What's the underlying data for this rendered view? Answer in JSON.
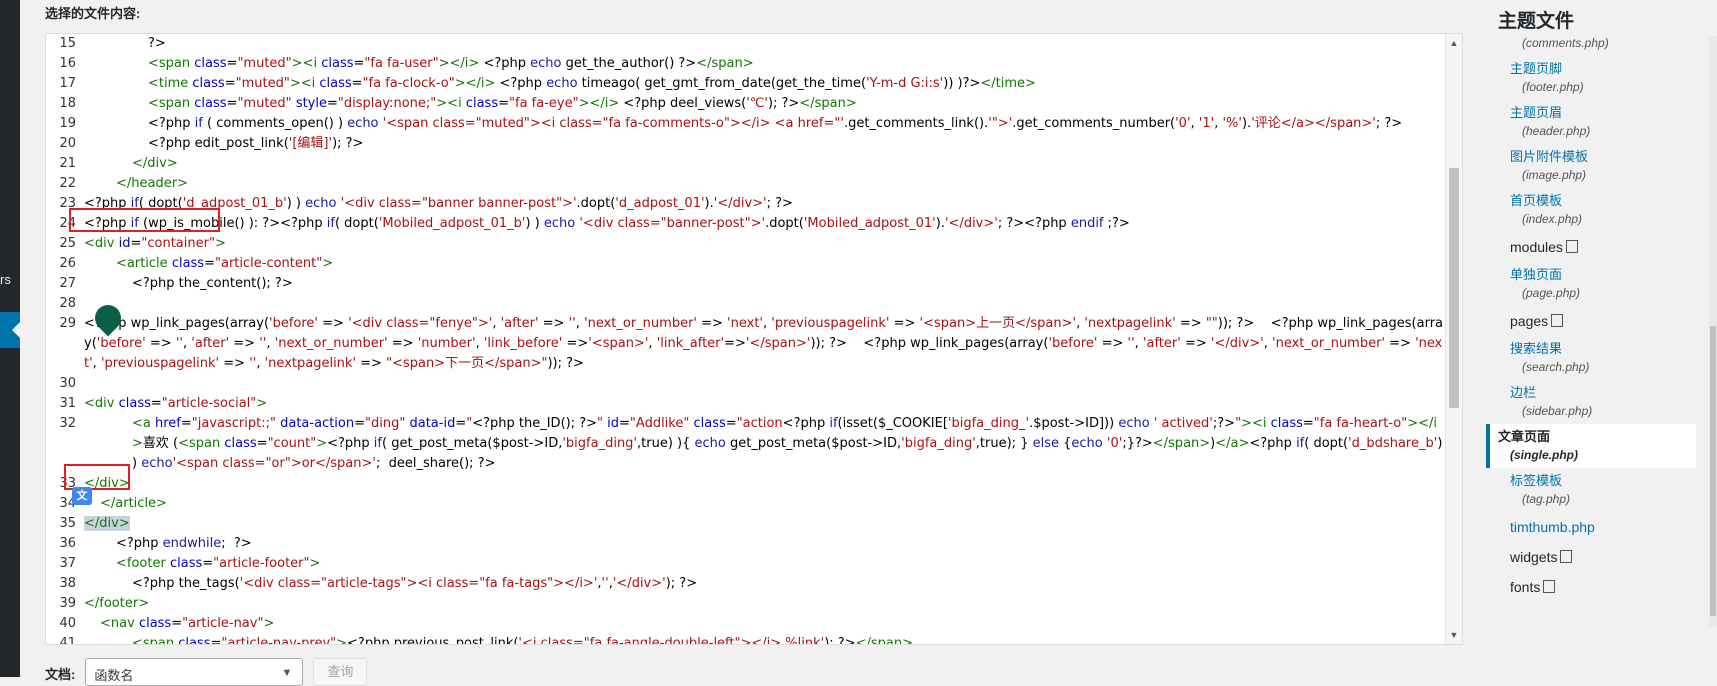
{
  "admin_strip": {
    "text": "rs"
  },
  "editor": {
    "content_label": "选择的文件内容:",
    "lines": [
      {
        "n": "15",
        "indent": 4,
        "html": "?>"
      },
      {
        "n": "16",
        "indent": 4,
        "html": "<span class=\"tag\">&lt;span</span> <span class=\"attr\">class</span>=<span class=\"str\">\"muted\"</span><span class=\"tag\">&gt;&lt;i</span> <span class=\"attr\">class</span>=<span class=\"str\">\"fa fa-user\"</span><span class=\"tag\">&gt;&lt;/i&gt;</span> &lt;?php <span class=\"kw\">echo</span> get_the_author() ?&gt;<span class=\"tag\">&lt;/span&gt;</span>"
      },
      {
        "n": "17",
        "indent": 4,
        "html": "<span class=\"tag\">&lt;time</span> <span class=\"attr\">class</span>=<span class=\"str\">\"muted\"</span><span class=\"tag\">&gt;&lt;i</span> <span class=\"attr\">class</span>=<span class=\"str\">\"fa fa-clock-o\"</span><span class=\"tag\">&gt;&lt;/i&gt;</span> &lt;?php <span class=\"kw\">echo</span> timeago( get_gmt_from_date(get_the_time(<span class=\"str\">'Y-m-d G:i:s'</span>)) )?&gt;<span class=\"tag\">&lt;/time&gt;</span>"
      },
      {
        "n": "18",
        "indent": 4,
        "html": "<span class=\"tag\">&lt;span</span> <span class=\"attr\">class</span>=<span class=\"str\">\"muted\"</span> <span class=\"attr\">style</span>=<span class=\"str\">\"display:none;\"</span><span class=\"tag\">&gt;&lt;i</span> <span class=\"attr\">class</span>=<span class=\"str\">\"fa fa-eye\"</span><span class=\"tag\">&gt;&lt;/i&gt;</span> &lt;?php deel_views(<span class=\"str\">'℃'</span>); ?&gt;<span class=\"tag\">&lt;/span&gt;</span>"
      },
      {
        "n": "19",
        "indent": 4,
        "html": "&lt;?php <span class=\"kw\">if</span> ( comments_open() ) <span class=\"kw\">echo</span> <span class=\"str\">'&lt;span class=\"muted\"&gt;&lt;i class=\"fa fa-comments-o\"&gt;&lt;/i&gt; &lt;a href=\"'</span>.get_comments_link().<span class=\"str\">'\"&gt;'</span>.get_comments_number(<span class=\"str\">'0'</span>, <span class=\"str\">'1'</span>, <span class=\"str\">'%'</span>).<span class=\"str\">'评论&lt;/a&gt;&lt;/span&gt;'</span>; ?&gt;"
      },
      {
        "n": "20",
        "indent": 4,
        "html": "&lt;?php edit_post_link(<span class=\"str\">'[编辑]'</span>); ?&gt;"
      },
      {
        "n": "21",
        "indent": 3,
        "html": "<span class=\"tag\">&lt;/div&gt;</span>"
      },
      {
        "n": "22",
        "indent": 2,
        "html": "<span class=\"tag\">&lt;/header&gt;</span>"
      },
      {
        "n": "23",
        "indent": 0,
        "html": "&lt;?php <span class=\"kw\">if</span>( dopt(<span class=\"str\">'d_adpost_01_b'</span>) ) <span class=\"kw\">echo</span> <span class=\"str\">'&lt;div class=\"banner banner-post\"&gt;'</span>.dopt(<span class=\"str\">'d_adpost_01'</span>).<span class=\"str\">'&lt;/div&gt;'</span>; ?&gt;"
      },
      {
        "n": "24",
        "indent": 0,
        "html": "&lt;?php <span class=\"kw\">if</span> (wp_is_mobile() ): ?&gt;&lt;?php <span class=\"kw\">if</span>( dopt(<span class=\"str\">'Mobiled_adpost_01_b'</span>) ) <span class=\"kw\">echo</span> <span class=\"str\">'&lt;div class=\"banner-post\"&gt;'</span>.dopt(<span class=\"str\">'Mobiled_adpost_01'</span>).<span class=\"str\">'&lt;/div&gt;'</span>; ?&gt;&lt;?php <span class=\"kw\">endif</span> ;?&gt;"
      },
      {
        "n": "25",
        "indent": 0,
        "html": "<span class=\"tag\">&lt;div</span> <span class=\"attr\">id</span>=<span class=\"str\">\"container\"</span><span class=\"tag\">&gt;</span>"
      },
      {
        "n": "26",
        "indent": 2,
        "html": "<span class=\"tag\">&lt;article</span> <span class=\"attr\">class</span>=<span class=\"str\">\"article-content\"</span><span class=\"tag\">&gt;</span>"
      },
      {
        "n": "27",
        "indent": 3,
        "html": "&lt;?php the_content(); ?&gt;"
      },
      {
        "n": "28",
        "indent": 0,
        "html": ""
      },
      {
        "n": "29",
        "indent": 0,
        "html": "&lt;?php wp_link_pages(array(<span class=\"str\">'before'</span> =&gt; <span class=\"str\">'&lt;div class=\"fenye\"&gt;'</span>, <span class=\"str\">'after'</span> =&gt; <span class=\"str\">''</span>, <span class=\"str\">'next_or_number'</span> =&gt; <span class=\"str\">'next'</span>, <span class=\"str\">'previouspagelink'</span> =&gt; <span class=\"str\">'&lt;span&gt;上一页&lt;/span&gt;'</span>, <span class=\"str\">'nextpagelink'</span> =&gt; <span class=\"str\">\"\"</span>)); ?&gt;&nbsp;&nbsp;&nbsp;&nbsp;&lt;?php wp_link_pages(array(<span class=\"str\">'before'</span> =&gt; <span class=\"str\">''</span>, <span class=\"str\">'after'</span> =&gt; <span class=\"str\">''</span>, <span class=\"str\">'next_or_number'</span> =&gt; <span class=\"str\">'number'</span>, <span class=\"str\">'link_before'</span> =&gt;<span class=\"str\">'&lt;span&gt;'</span>, <span class=\"str\">'link_after'</span>=&gt;<span class=\"str\">'&lt;/span&gt;'</span>)); ?&gt;&nbsp;&nbsp;&nbsp;&nbsp;&lt;?php wp_link_pages(array(<span class=\"str\">'before'</span> =&gt; <span class=\"str\">''</span>, <span class=\"str\">'after'</span> =&gt; <span class=\"str\">'&lt;/div&gt;'</span>, <span class=\"str\">'next_or_number'</span> =&gt; <span class=\"str\">'next'</span>, <span class=\"str\">'previouspagelink'</span> =&gt; <span class=\"str\">''</span>, <span class=\"str\">'nextpagelink'</span> =&gt; <span class=\"str\">\"&lt;span&gt;下一页&lt;/span&gt;\"</span>)); ?&gt;"
      },
      {
        "n": "30",
        "indent": 0,
        "html": ""
      },
      {
        "n": "31",
        "indent": 0,
        "html": "<span class=\"tag\">&lt;div</span> <span class=\"attr\">class</span>=<span class=\"str\">\"article-social\"</span><span class=\"tag\">&gt;</span>"
      },
      {
        "n": "32",
        "indent": 3,
        "html": "<span class=\"tag\">&lt;a</span> <span class=\"attr\">href</span>=<span class=\"str\">\"javascript:;\"</span> <span class=\"attr\">data-action</span>=<span class=\"str\">\"ding\"</span> <span class=\"attr\">data-id</span>=<span class=\"str\">\"</span>&lt;?php the_ID(); ?&gt;<span class=\"str\">\"</span> <span class=\"attr\">id</span>=<span class=\"str\">\"Addlike\"</span> <span class=\"attr\">class</span>=<span class=\"str\">\"action</span>&lt;?php <span class=\"kw\">if</span>(isset($_COOKIE[<span class=\"str\">'bigfa_ding_'</span>.$post-&gt;ID])) <span class=\"kw\">echo</span> <span class=\"str\">' actived'</span>;?&gt;<span class=\"str\">\"</span><span class=\"tag\">&gt;&lt;i</span> <span class=\"attr\">class</span>=<span class=\"str\">\"fa fa-heart-o\"</span><span class=\"tag\">&gt;&lt;/i&gt;</span>喜欢 (<span class=\"tag\">&lt;span</span> <span class=\"attr\">class</span>=<span class=\"str\">\"count\"</span><span class=\"tag\">&gt;</span>&lt;?php <span class=\"kw\">if</span>( get_post_meta($post-&gt;ID,<span class=\"str\">'bigfa_ding'</span>,true) ){ <span class=\"kw\">echo</span> get_post_meta($post-&gt;ID,<span class=\"str\">'bigfa_ding'</span>,true); } <span class=\"kw\">else</span> {<span class=\"kw\">echo</span> <span class=\"str\">'0'</span>;}?&gt;<span class=\"tag\">&lt;/span&gt;</span>)<span class=\"tag\">&lt;/a&gt;</span>&lt;?php <span class=\"kw\">if</span>( dopt(<span class=\"str\">'d_bdshare_b'</span>) ) <span class=\"kw\">echo</span><span class=\"str\">'&lt;span class=\"or\"&gt;or&lt;/span&gt;'</span>;&nbsp; deel_share(); ?&gt;"
      },
      {
        "n": "33",
        "indent": 0,
        "html": "<span class=\"tag\">&lt;/div&gt;</span>"
      },
      {
        "n": "34",
        "indent": 1,
        "html": "<span class=\"tag\">&lt;/article&gt;</span>"
      },
      {
        "n": "35",
        "indent": 0,
        "html": "<span class=\"sel\"><span class=\"tag\">&lt;/div&gt;</span></span>"
      },
      {
        "n": "36",
        "indent": 2,
        "html": "&lt;?php <span class=\"kw\">endwhile</span>;&nbsp; ?&gt;"
      },
      {
        "n": "37",
        "indent": 2,
        "html": "<span class=\"tag\">&lt;footer</span> <span class=\"attr\">class</span>=<span class=\"str\">\"article-footer\"</span><span class=\"tag\">&gt;</span>"
      },
      {
        "n": "38",
        "indent": 3,
        "html": "&lt;?php the_tags(<span class=\"str\">'&lt;div class=\"article-tags\"&gt;&lt;i class=\"fa fa-tags\"&gt;&lt;/i&gt;'</span>,<span class=\"str\">''</span>,<span class=\"str\">'&lt;/div&gt;'</span>); ?&gt;"
      },
      {
        "n": "39",
        "indent": 0,
        "html": "<span class=\"tag\">&lt;/footer&gt;</span>"
      },
      {
        "n": "40",
        "indent": 1,
        "html": "<span class=\"tag\">&lt;nav</span> <span class=\"attr\">class</span>=<span class=\"str\">\"article-nav\"</span><span class=\"tag\">&gt;</span>"
      },
      {
        "n": "41",
        "indent": 3,
        "html": "<span class=\"tag\">&lt;span</span> <span class=\"attr\">class</span>=<span class=\"str\">\"article-nav-prev\"</span><span class=\"tag\">&gt;</span>&lt;?php previous_post_link(<span class=\"str\">'&lt;i class=\"fa fa-angle-double-left\"&gt;&lt;/i&gt; %link'</span>); ?&gt;<span class=\"tag\">&lt;/span&gt;</span>"
      }
    ]
  },
  "bottom_bar": {
    "doc_label": "文档:",
    "function_select_value": "函数名",
    "lookup_label": "查询"
  },
  "sidebar": {
    "title": "主题文件",
    "items": [
      {
        "name": "",
        "path": "(comments.php)",
        "kind": "file"
      },
      {
        "name": "主题页脚",
        "path": "(footer.php)",
        "kind": "file"
      },
      {
        "name": "主题页眉",
        "path": "(header.php)",
        "kind": "file"
      },
      {
        "name": "图片附件模板",
        "path": "(image.php)",
        "kind": "file"
      },
      {
        "name": "首页模板",
        "path": "(index.php)",
        "kind": "file"
      },
      {
        "name": "modules",
        "path": "",
        "kind": "dir"
      },
      {
        "name": "单独页面",
        "path": "(page.php)",
        "kind": "file"
      },
      {
        "name": "pages",
        "path": "",
        "kind": "dir"
      },
      {
        "name": "搜索结果",
        "path": "(search.php)",
        "kind": "file"
      },
      {
        "name": "边栏",
        "path": "(sidebar.php)",
        "kind": "file"
      },
      {
        "name": "文章页面",
        "path": "(single.php)",
        "kind": "file",
        "active": true
      },
      {
        "name": "标签模板",
        "path": "(tag.php)",
        "kind": "file"
      },
      {
        "name": "timthumb.php",
        "path": "",
        "kind": "plain"
      },
      {
        "name": "widgets",
        "path": "",
        "kind": "dir"
      },
      {
        "name": "fonts",
        "path": "",
        "kind": "dir"
      }
    ]
  }
}
